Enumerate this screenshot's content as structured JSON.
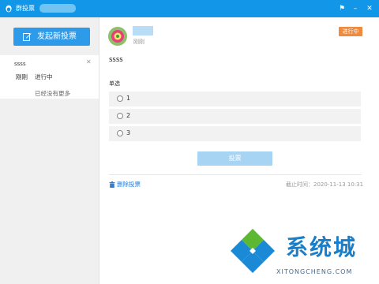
{
  "window": {
    "title": "群投票",
    "buttons": [
      "pin",
      "minimize",
      "close"
    ]
  },
  "sidebar": {
    "new_vote_label": "发起新投票",
    "polls": [
      {
        "name": "ssss",
        "time": "刚刚",
        "status": "进行中"
      }
    ],
    "no_more": "已经没有更多"
  },
  "main": {
    "post_time": "刚刚",
    "status_badge": "进行中",
    "poll_title": "ssss",
    "poll_type": "单选",
    "options": [
      "1",
      "2",
      "3"
    ],
    "vote_label": "投票",
    "delete_label": "删除投票",
    "deadline": "截止时间：2020-11-13 10:31"
  },
  "watermark": {
    "text": "系统城",
    "sub": "XITONGCHENG.COM"
  },
  "colors": {
    "titlebar": "#1196e8",
    "primary_button": "#2d9bea",
    "status_badge": "#f08a3c",
    "vote_button_disabled": "#a8d4f4",
    "link": "#2d7fd6"
  }
}
